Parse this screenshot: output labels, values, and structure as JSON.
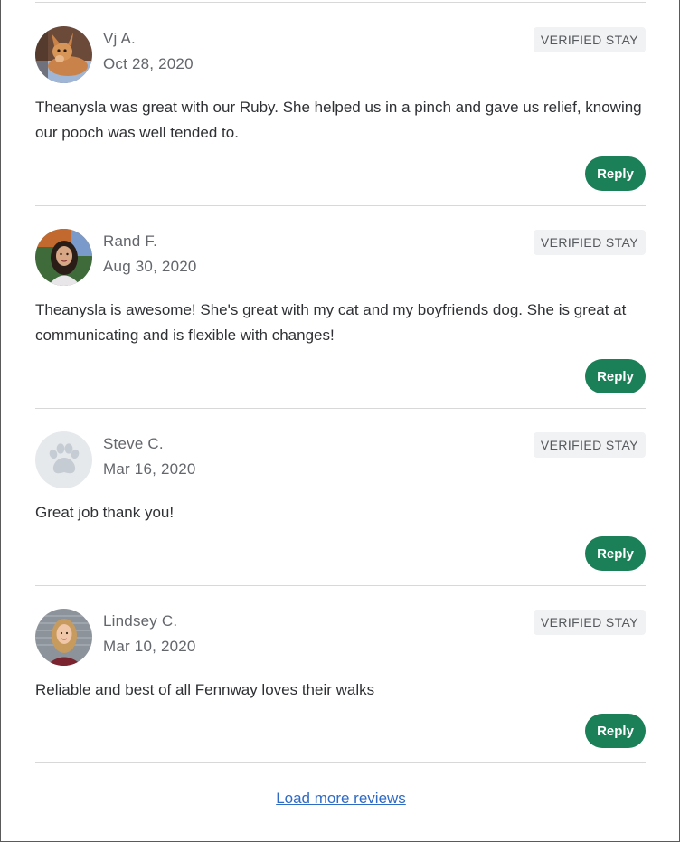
{
  "reviews": [
    {
      "name": "Vj A.",
      "date": "Oct 28, 2020",
      "badge": "VERIFIED STAY",
      "text": "Theanysla was great with our Ruby. She helped us in a pinch and gave us relief, knowing our pooch was well tended to.",
      "reply_label": "Reply",
      "avatar": "dog-photo-avatar"
    },
    {
      "name": "Rand F.",
      "date": "Aug 30, 2020",
      "badge": "VERIFIED STAY",
      "text": "Theanysla is awesome! She's great with my cat and my boyfriends dog. She is great at communicating and is flexible with changes!",
      "reply_label": "Reply",
      "avatar": "woman-photo-avatar"
    },
    {
      "name": "Steve C.",
      "date": "Mar 16, 2020",
      "badge": "VERIFIED STAY",
      "text": "Great job thank you!",
      "reply_label": "Reply",
      "avatar": "paw-placeholder-avatar"
    },
    {
      "name": "Lindsey C.",
      "date": "Mar 10, 2020",
      "badge": "VERIFIED STAY",
      "text": "Reliable and best of all Fennway loves their walks",
      "reply_label": "Reply",
      "avatar": "woman-photo-avatar"
    }
  ],
  "load_more_label": "Load more reviews",
  "colors": {
    "reply_button": "#1b7f57",
    "link": "#2f6bc4",
    "badge_bg": "#f1f2f3",
    "divider": "#d8d8d8"
  }
}
